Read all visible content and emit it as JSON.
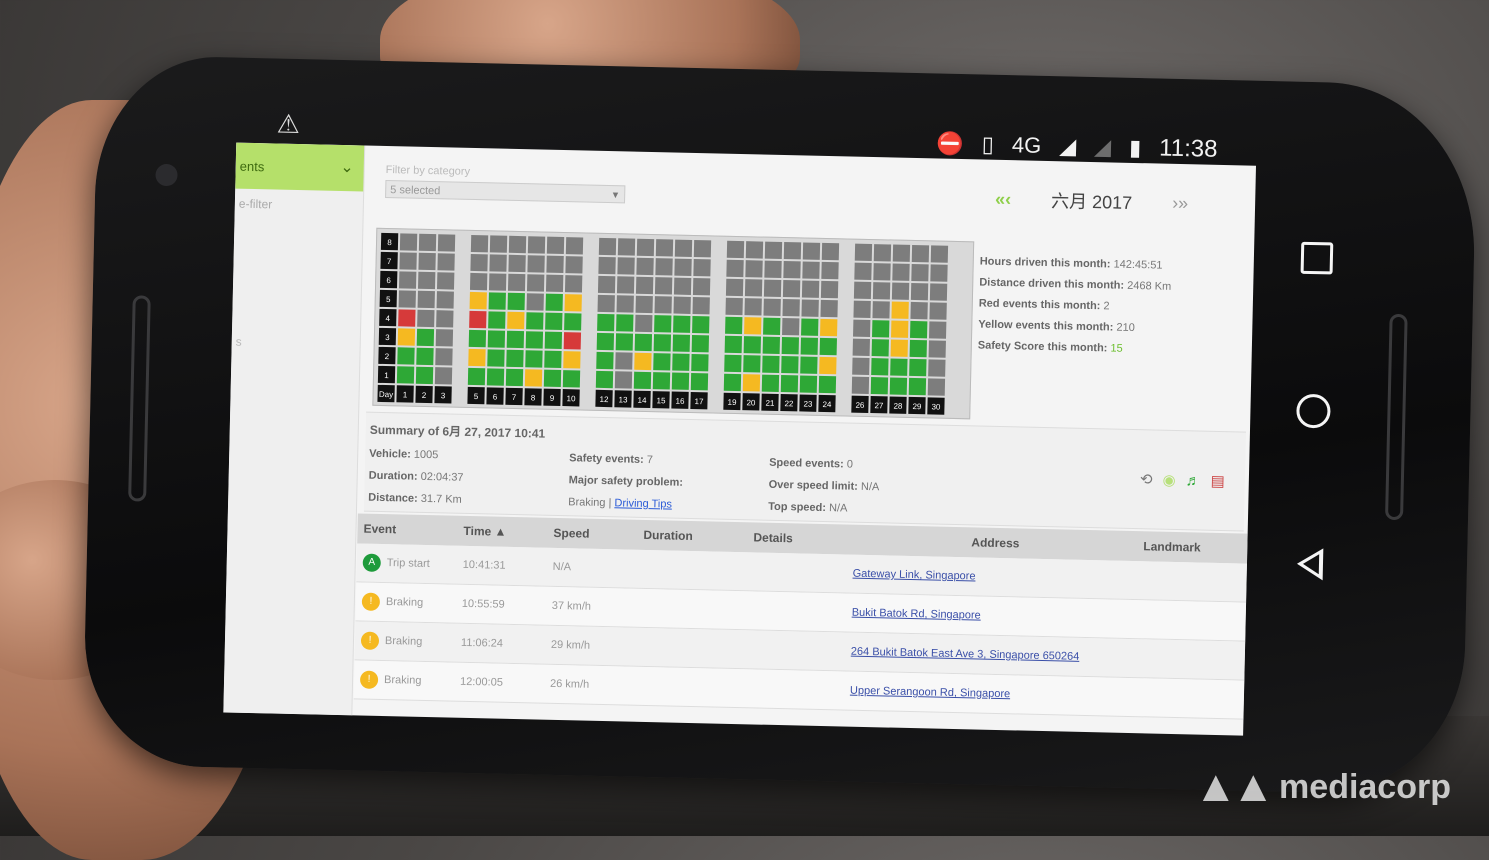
{
  "status_bar": {
    "network": "4G",
    "time": "11:38"
  },
  "sidebar": {
    "active_label": "ents",
    "sub_label": "e-filter",
    "fragment": "s"
  },
  "filter": {
    "label": "Filter by category",
    "value": "5 selected"
  },
  "month_nav": {
    "prev": "«‹",
    "label": "六月 2017",
    "next": "›»"
  },
  "calendar": {
    "row_labels": [
      "8",
      "7",
      "6",
      "5",
      "4",
      "3",
      "2",
      "1",
      "Day"
    ],
    "days": [
      "1",
      "2",
      "3",
      "5",
      "6",
      "7",
      "8",
      "9",
      "10",
      "12",
      "13",
      "14",
      "15",
      "16",
      "17",
      "19",
      "20",
      "21",
      "22",
      "23",
      "24",
      "26",
      "27",
      "28",
      "29",
      "30"
    ],
    "colors": {
      "green": "#2ea836",
      "yellow": "#f5b921",
      "red": "#d63a3a",
      "grey": "#7d7d7d"
    }
  },
  "stats": {
    "hours_label": "Hours driven this month:",
    "hours_value": "142:45:51",
    "distance_label": "Distance driven this month:",
    "distance_value": "2468 Km",
    "red_label": "Red events this month:",
    "red_value": "2",
    "yellow_label": "Yellow events this month:",
    "yellow_value": "210",
    "score_label": "Safety Score this month:",
    "score_value": "15"
  },
  "summary": {
    "title": "Summary of 6月 27, 2017 10:41",
    "vehicle_label": "Vehicle:",
    "vehicle_value": "1005",
    "duration_label": "Duration:",
    "duration_value": "02:04:37",
    "distance_label": "Distance:",
    "distance_value": "31.7 Km",
    "safety_events_label": "Safety events:",
    "safety_events_value": "7",
    "major_problem_label": "Major safety problem:",
    "major_problem_value": "Braking",
    "driving_tips": "Driving Tips",
    "speed_events_label": "Speed events:",
    "speed_events_value": "0",
    "overspeed_label": "Over speed limit:",
    "overspeed_value": "N/A",
    "top_speed_label": "Top speed:",
    "top_speed_value": "N/A"
  },
  "table": {
    "headers": [
      "Event",
      "Time ▲",
      "Speed",
      "Duration",
      "Details",
      "Address",
      "Landmark"
    ],
    "rows": [
      {
        "event": "Trip start",
        "icon": "A",
        "time": "10:41:31",
        "speed": "N/A",
        "address": "Gateway Link, Singapore"
      },
      {
        "event": "Braking",
        "icon": "!",
        "time": "10:55:59",
        "speed": "37 km/h",
        "address": "Bukit Batok Rd, Singapore"
      },
      {
        "event": "Braking",
        "icon": "!",
        "time": "11:06:24",
        "speed": "29 km/h",
        "address": "264 Bukit Batok East Ave 3, Singapore 650264"
      },
      {
        "event": "Braking",
        "icon": "!",
        "time": "12:00:05",
        "speed": "26 km/h",
        "address": "Upper Serangoon Rd, Singapore"
      }
    ]
  },
  "watermark": "mediacorp"
}
